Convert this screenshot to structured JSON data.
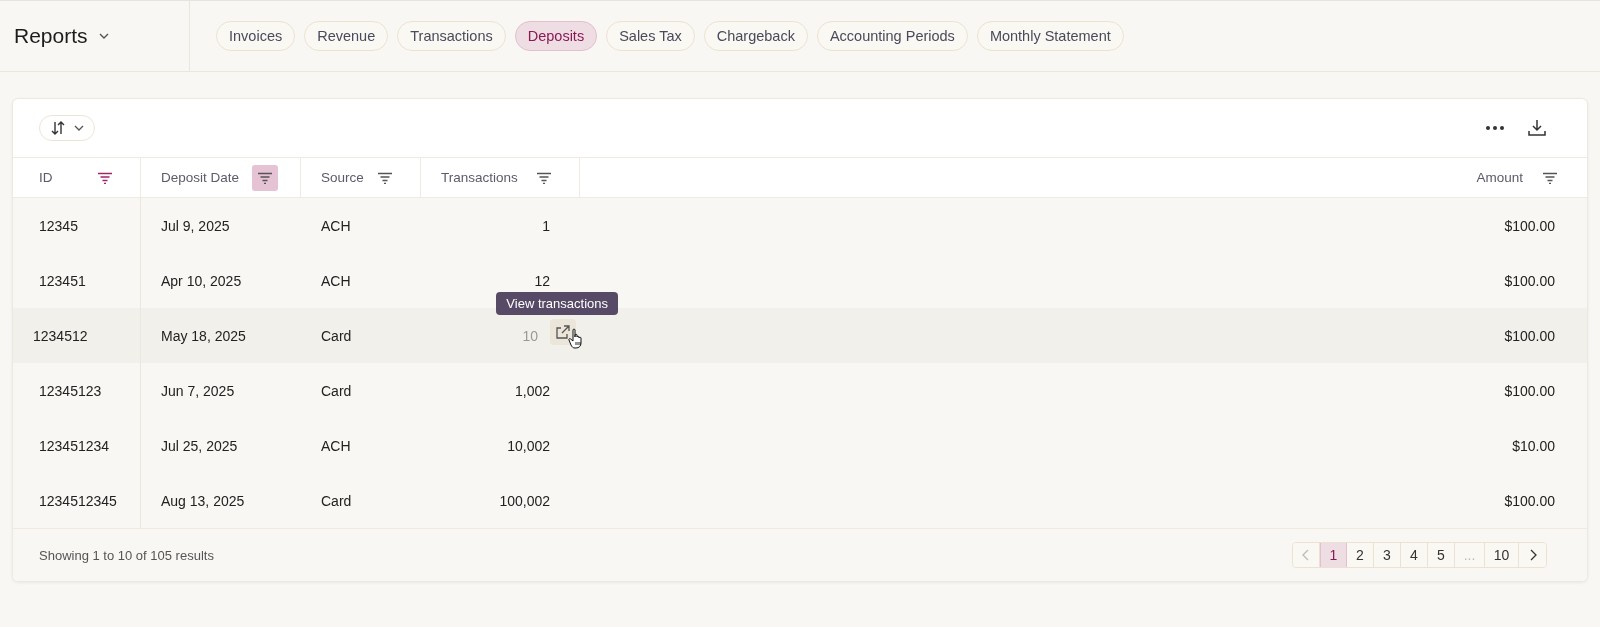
{
  "header": {
    "title": "Reports"
  },
  "tabs": [
    {
      "label": "Invoices",
      "selected": false
    },
    {
      "label": "Revenue",
      "selected": false
    },
    {
      "label": "Transactions",
      "selected": false
    },
    {
      "label": "Deposits",
      "selected": true
    },
    {
      "label": "Sales Tax",
      "selected": false
    },
    {
      "label": "Chargeback",
      "selected": false
    },
    {
      "label": "Accounting Periods",
      "selected": false
    },
    {
      "label": "Monthly Statement",
      "selected": false
    }
  ],
  "table": {
    "columns": [
      {
        "label": "ID",
        "filter_active": true,
        "hovered": false
      },
      {
        "label": "Deposit Date",
        "filter_active": false,
        "hovered": true
      },
      {
        "label": "Source",
        "filter_active": false,
        "hovered": false
      },
      {
        "label": "Transactions",
        "filter_active": false,
        "hovered": false
      },
      {
        "label": "Amount",
        "filter_active": false,
        "hovered": false
      }
    ],
    "rows": [
      {
        "cells": [
          "12345",
          "Jul 9, 2025",
          "ACH",
          "1",
          "$100.00"
        ],
        "hovered": false
      },
      {
        "cells": [
          "123451",
          "Apr 10, 2025",
          "ACH",
          "12",
          "$100.00"
        ],
        "hovered": false
      },
      {
        "cells": [
          "1234512",
          "May 18, 2025",
          "Card",
          "10",
          "$100.00"
        ],
        "hovered": true
      },
      {
        "cells": [
          "12345123",
          "Jun 7, 2025",
          "Card",
          "1,002",
          "$100.00"
        ],
        "hovered": false
      },
      {
        "cells": [
          "123451234",
          "Jul 25, 2025",
          "ACH",
          "10,002",
          "$10.00"
        ],
        "hovered": false
      },
      {
        "cells": [
          "1234512345",
          "Aug 13, 2025",
          "Card",
          "100,002",
          "$100.00"
        ],
        "hovered": false
      }
    ]
  },
  "tooltip": "View transactions",
  "footer": {
    "summary": "Showing 1 to 10 of 105 results",
    "pages": [
      {
        "label": "1",
        "selected": true
      },
      {
        "label": "2",
        "selected": false
      },
      {
        "label": "3",
        "selected": false
      },
      {
        "label": "4",
        "selected": false
      },
      {
        "label": "5",
        "selected": false
      },
      {
        "label": "...",
        "selected": false,
        "kind": "gap"
      },
      {
        "label": "10",
        "selected": false
      }
    ],
    "prev_disabled": true
  }
}
